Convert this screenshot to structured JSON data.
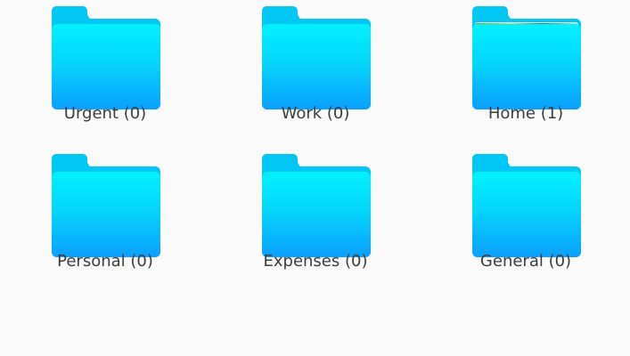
{
  "folders": [
    {
      "label": "Urgent (0)",
      "icon": "folder-icon",
      "has_photos": false
    },
    {
      "label": "Work (0)",
      "icon": "folder-icon",
      "has_photos": false
    },
    {
      "label": "Home (1)",
      "icon": "folder-with-photos-icon",
      "has_photos": true
    },
    {
      "label": "Personal (0)",
      "icon": "folder-icon",
      "has_photos": false
    },
    {
      "label": "Expenses (0)",
      "icon": "folder-icon",
      "has_photos": false
    },
    {
      "label": "General (0)",
      "icon": "folder-icon",
      "has_photos": false
    }
  ],
  "colors": {
    "background": "#fafafa",
    "folder_top": "#03f1ff",
    "folder_bottom": "#0a9fff",
    "label_text": "#3c3c3c"
  }
}
